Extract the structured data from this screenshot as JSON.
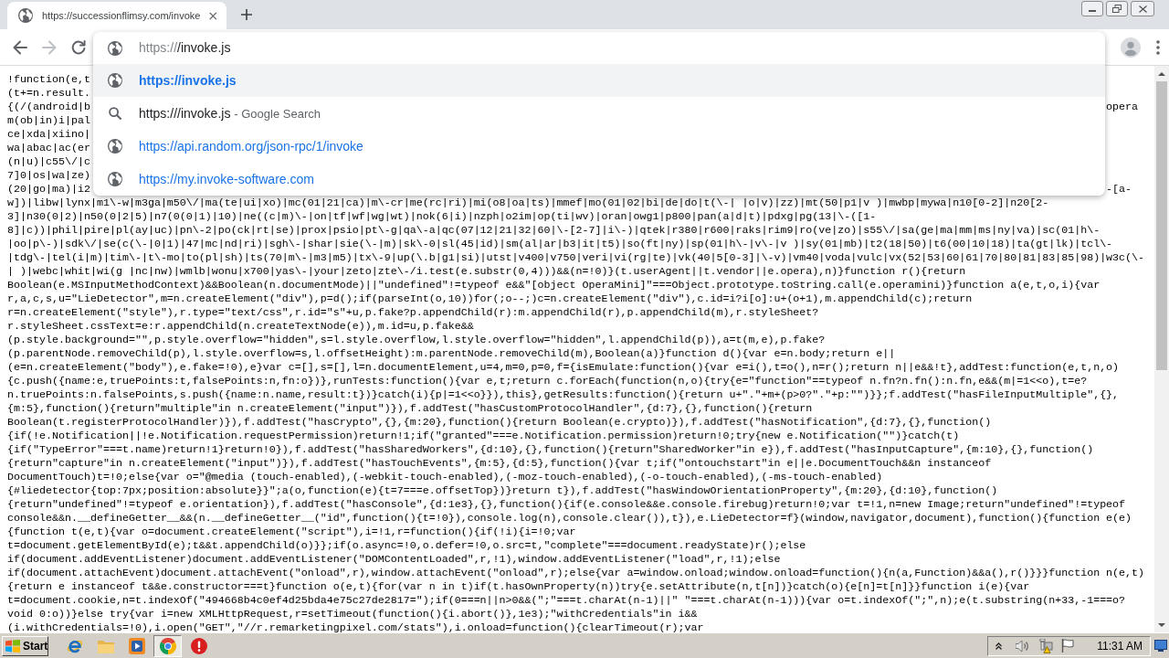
{
  "tabs": [
    {
      "title": "https://successionflimsy.com/invoke",
      "selected": true
    }
  ],
  "toolbar": {
    "nav": [
      {
        "kind": "back",
        "disabled": false
      },
      {
        "kind": "forward",
        "disabled": true
      },
      {
        "kind": "reload",
        "disabled": false
      }
    ]
  },
  "omnibox": {
    "scheme": "https://",
    "text": "/invoke.js"
  },
  "suggestions": [
    {
      "kind": "url",
      "text": "https://invoke.js",
      "selected": true
    },
    {
      "kind": "search",
      "text": "https:///invoke.js",
      "description": "- Google Search",
      "selected": false
    },
    {
      "kind": "url",
      "text": "https://api.random.org/json-rpc/1/invoke",
      "selected": false
    },
    {
      "kind": "url",
      "text": "https://my.invoke-software.com",
      "selected": false
    }
  ],
  "page": {
    "lines": [
      {
        "left": "!function(e,t"
      },
      {
        "left": "(t+=n.result."
      },
      {
        "left": "{(/(android|b",
        "right": "opera"
      },
      {
        "left": "m(ob|in)i|pal"
      },
      {
        "left": "ce|xda|xiino|"
      },
      {
        "left": "wa|abac|ac(er"
      },
      {
        "left": "(n|u)|c55\\/|c"
      },
      {
        "left": "7]0|os|wa|ze)"
      },
      {
        "left": "(20|go|ma)|i2",
        "right": "-[a-"
      },
      {
        "text": "w])|libw|lynx|m1\\-w|m3ga|m50\\/|ma(te|ui|xo)|mc(01|21|ca)|m\\-cr|me(rc|ri)|mi(o8|oa|ts)|mmef|mo(01|02|bi|de|do|t(\\-| |o|v)|zz)|mt(50|p1|v )|mwbp|mywa|n10[0-2]|n20[2-"
      },
      {
        "text": "3]|n30(0|2)|n50(0|2|5)|n7(0(0|1)|10)|ne((c|m)\\-|on|tf|wf|wg|wt)|nok(6|i)|nzph|o2im|op(ti|wv)|oran|owg1|p800|pan(a|d|t)|pdxg|pg(13|\\-([1-"
      },
      {
        "text": "8]|c))|phil|pire|pl(ay|uc)|pn\\-2|po(ck|rt|se)|prox|psio|pt\\-g|qa\\-a|qc(07|12|21|32|60|\\-[2-7]|i\\-)|qtek|r380|r600|raks|rim9|ro(ve|zo)|s55\\/|sa(ge|ma|mm|ms|ny|va)|sc(01|h\\-"
      },
      {
        "text": "|oo|p\\-)|sdk\\/|se(c(\\-|0|1)|47|mc|nd|ri)|sgh\\-|shar|sie(\\-|m)|sk\\-0|sl(45|id)|sm(al|ar|b3|it|t5)|so(ft|ny)|sp(01|h\\-|v\\-|v )|sy(01|mb)|t2(18|50)|t6(00|10|18)|ta(gt|lk)|tcl\\-"
      },
      {
        "text": "|tdg\\-|tel(i|m)|tim\\-|t\\-mo|to(pl|sh)|ts(70|m\\-|m3|m5)|tx\\-9|up(\\.b|g1|si)|utst|v400|v750|veri|vi(rg|te)|vk(40|5[0-3]|\\-v)|vm40|voda|vulc|vx(52|53|60|61|70|80|81|83|85|98)|w3c(\\-"
      },
      {
        "text": "| )|webc|whit|wi(g |nc|nw)|wmlb|wonu|x700|yas\\-|your|zeto|zte\\-/i.test(e.substr(0,4)))&&(n=!0)}(t.userAgent||t.vendor||e.opera),n)}function r(){return"
      },
      {
        "text": "Boolean(e.MSInputMethodContext)&&Boolean(n.documentMode)||\"undefined\"!=typeof e&&\"[object OperaMini]\"===Object.prototype.toString.call(e.operamini)}function a(e,t,o,i){var"
      },
      {
        "text": "r,a,c,s,u=\"LieDetector\",m=n.createElement(\"div\"),p=d();if(parseInt(o,10))for(;o--;)c=n.createElement(\"div\"),c.id=i?i[o]:u+(o+1),m.appendChild(c);return"
      },
      {
        "text": "r=n.createElement(\"style\"),r.type=\"text/css\",r.id=\"s\"+u,p.fake?p.appendChild(r):m.appendChild(r),p.appendChild(m),r.styleSheet?"
      },
      {
        "text": "r.styleSheet.cssText=e:r.appendChild(n.createTextNode(e)),m.id=u,p.fake&&"
      },
      {
        "text": "(p.style.background=\"\",p.style.overflow=\"hidden\",s=l.style.overflow,l.style.overflow=\"hidden\",l.appendChild(p)),a=t(m,e),p.fake?"
      },
      {
        "text": "(p.parentNode.removeChild(p),l.style.overflow=s,l.offsetHeight):m.parentNode.removeChild(m),Boolean(a)}function d(){var e=n.body;return e||"
      },
      {
        "text": "(e=n.createElement(\"body\"),e.fake=!0),e}var c=[],s=[],l=n.documentElement,u=4,m=0,p=0,f={isEmulate:function(){var e=i(),t=o(),n=r();return n||e&&!t},addTest:function(e,t,n,o)"
      },
      {
        "text": "{c.push({name:e,truePoints:t,falsePoints:n,fn:o})},runTests:function(){var e,t;return c.forEach(function(n,o){try{e=\"function\"==typeof n.fn?n.fn():n.fn,e&&(m|=1<<o),t=e?"
      },
      {
        "text": "n.truePoints:n.falsePoints,s.push({name:n.name,result:t})}catch(i){p|=1<<o}}),this},getResults:function(){return u+\".\"+m+(p>0?\".\"+p:\"\")}};f.addTest(\"hasFileInputMultiple\",{},"
      },
      {
        "text": "{m:5},function(){return\"multiple\"in n.createElement(\"input\")}),f.addTest(\"hasCustomProtocolHandler\",{d:7},{},function(){return"
      },
      {
        "text": "Boolean(t.registerProtocolHandler)}),f.addTest(\"hasCrypto\",{},{m:20},function(){return Boolean(e.crypto)}),f.addTest(\"hasNotification\",{d:7},{},function()"
      },
      {
        "text": "{if(!e.Notification||!e.Notification.requestPermission)return!1;if(\"granted\"===e.Notification.permission)return!0;try{new e.Notification(\"\")}catch(t)"
      },
      {
        "text": "{if(\"TypeError\"===t.name)return!1}return!0}),f.addTest(\"hasSharedWorkers\",{d:10},{},function(){return\"SharedWorker\"in e}),f.addTest(\"hasInputCapture\",{m:10},{},function()"
      },
      {
        "text": "{return\"capture\"in n.createElement(\"input\")}),f.addTest(\"hasTouchEvents\",{m:5},{d:5},function(){var t;if(\"ontouchstart\"in e||e.DocumentTouch&&n instanceof"
      },
      {
        "text": "DocumentTouch)t=!0;else{var o=\"@media (touch-enabled),(-webkit-touch-enabled),(-moz-touch-enabled),(-o-touch-enabled),(-ms-touch-enabled)"
      },
      {
        "text": "{#liedetector{top:7px;position:absolute}}\";a(o,function(e){t=7===e.offsetTop})}return t}),f.addTest(\"hasWindowOrientationProperty\",{m:20},{d:10},function()"
      },
      {
        "text": "{return\"undefined\"!=typeof e.orientation}),f.addTest(\"hasConsole\",{d:1e3},{},function(){if(e.console&&e.console.firebug)return!0;var t=!1,n=new Image;return\"undefined\"!=typeof"
      },
      {
        "text": "console&&n.__defineGetter__&&(n.__defineGetter__(\"id\",function(){t=!0}),console.log(n),console.clear()),t}),e.LieDetector=f}(window,navigator,document),function(){function e(e)"
      },
      {
        "text": "{function t(e,t){var o=document.createElement(\"script\"),i=!1,r=function(){if(!i){i=!0;var"
      },
      {
        "text": "t=document.getElementById(e);t&&t.appendChild(o)}};if(o.async=!0,o.defer=!0,o.src=t,\"complete\"===document.readyState)r();else"
      },
      {
        "text": "if(document.addEventListener)document.addEventListener(\"DOMContentLoaded\",r,!1),window.addEventListener(\"load\",r,!1);else"
      },
      {
        "text": "if(document.attachEvent)document.attachEvent(\"onload\",r),window.attachEvent(\"onload\",r);else{var a=window.onload;window.onload=function(){n(a,Function)&&a(),r()}}}function n(e,t)"
      },
      {
        "text": "{return e instanceof t&&e.constructor===t}function o(e,t){for(var n in t)if(t.hasOwnProperty(n))try{e.setAttribute(n,t[n])}catch(o){e[n]=t[n]}}function i(e){var"
      },
      {
        "text": "t=document.cookie,n=t.indexOf(\"494668b4c0ef4d25bda4e75c27de2817=\");if(0===n||n>0&&(\";\"===t.charAt(n-1)||\" \"===t.charAt(n-1))){var o=t.indexOf(\";\",n);e(t.substring(n+33,-1===o?"
      },
      {
        "text": "void 0:o))}else try{var i=new XMLHttpRequest,r=setTimeout(function(){i.abort()},1e3);\"withCredentials\"in i&&"
      },
      {
        "text": "(i.withCredentials=!0),i.open(\"GET\",\"//r.remarketingpixel.com/stats\"),i.onload=function(){clearTimeout(r);var"
      }
    ]
  },
  "taskbar": {
    "start": "Start",
    "apps": [
      {
        "kind": "browser",
        "selected": false
      },
      {
        "kind": "folder",
        "selected": false
      },
      {
        "kind": "media",
        "selected": false
      },
      {
        "kind": "chrome",
        "selected": true
      },
      {
        "kind": "alert",
        "selected": false
      }
    ],
    "clock": "11:31 AM"
  }
}
